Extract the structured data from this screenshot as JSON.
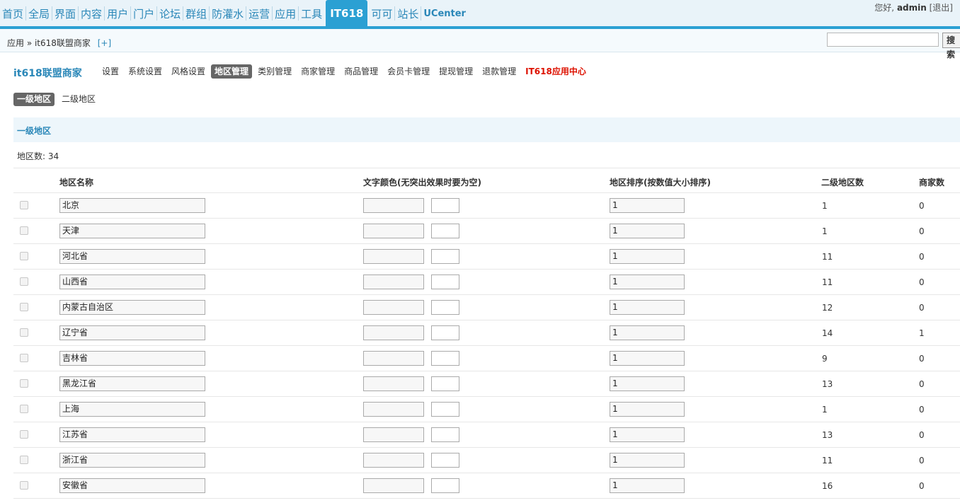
{
  "nav": {
    "items": [
      "首页",
      "全局",
      "界面",
      "内容",
      "用户",
      "门户",
      "论坛",
      "群组",
      "防灌水",
      "运营",
      "应用",
      "工具",
      "IT618",
      "可可",
      "站长",
      "UCenter"
    ],
    "active": "IT618",
    "greeting_prefix": "您好,",
    "user": "admin",
    "logout": "[退出]"
  },
  "breadcrumb": {
    "path": "应用 » it618联盟商家",
    "add": "[+]"
  },
  "search": {
    "value": "",
    "button": "搜索"
  },
  "plugin": {
    "title": "it618联盟商家",
    "menu": [
      "设置",
      "系统设置",
      "风格设置",
      "地区管理",
      "类别管理",
      "商家管理",
      "商品管理",
      "会员卡管理",
      "提现管理",
      "退款管理",
      "IT618应用中心"
    ],
    "active_menu": "地区管理"
  },
  "subtabs": {
    "items": [
      "一级地区",
      "二级地区"
    ],
    "active": "一级地区"
  },
  "section_title": "一级地区",
  "region_count": "地区数: 34",
  "table": {
    "headers": {
      "name": "地区名称",
      "color": "文字颜色(无突出效果时要为空)",
      "order": "地区排序(按数值大小排序)",
      "sub_count": "二级地区数",
      "merchant_count": "商家数"
    },
    "rows": [
      {
        "name": "北京",
        "order": "1",
        "sub_count": "1",
        "merchant_count": "0"
      },
      {
        "name": "天津",
        "order": "1",
        "sub_count": "1",
        "merchant_count": "0"
      },
      {
        "name": "河北省",
        "order": "1",
        "sub_count": "11",
        "merchant_count": "0"
      },
      {
        "name": "山西省",
        "order": "1",
        "sub_count": "11",
        "merchant_count": "0"
      },
      {
        "name": "内蒙古自治区",
        "order": "1",
        "sub_count": "12",
        "merchant_count": "0"
      },
      {
        "name": "辽宁省",
        "order": "1",
        "sub_count": "14",
        "merchant_count": "1"
      },
      {
        "name": "吉林省",
        "order": "1",
        "sub_count": "9",
        "merchant_count": "0"
      },
      {
        "name": "黑龙江省",
        "order": "1",
        "sub_count": "13",
        "merchant_count": "0"
      },
      {
        "name": "上海",
        "order": "1",
        "sub_count": "1",
        "merchant_count": "0"
      },
      {
        "name": "江苏省",
        "order": "1",
        "sub_count": "13",
        "merchant_count": "0"
      },
      {
        "name": "浙江省",
        "order": "1",
        "sub_count": "11",
        "merchant_count": "0"
      },
      {
        "name": "安徽省",
        "order": "1",
        "sub_count": "16",
        "merchant_count": "0"
      }
    ]
  },
  "colors": {
    "accent": "#2ba0d3",
    "link": "#2a87b8",
    "active_tab": "#666666",
    "highlight_red": "#dd1100"
  }
}
